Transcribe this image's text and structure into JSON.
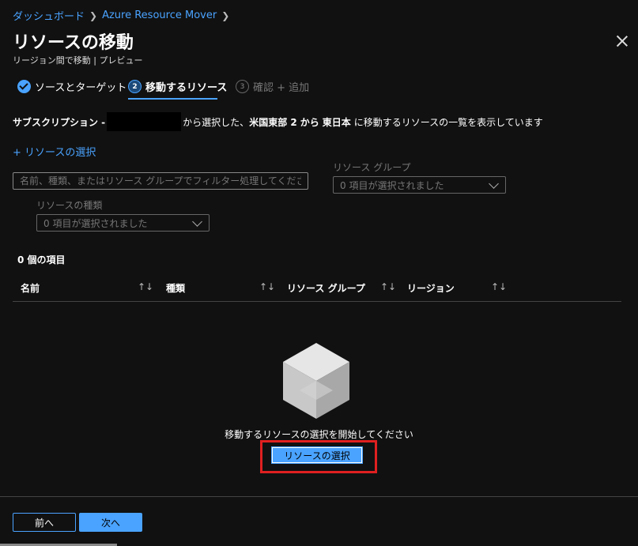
{
  "breadcrumb": [
    "ダッシュボード",
    "Azure Resource Mover"
  ],
  "header": {
    "title": "リソースの移動",
    "subtitle": "リージョン間で移動 | プレビュー"
  },
  "steps": [
    {
      "label": "ソースとターゲット",
      "state": "done"
    },
    {
      "number": "2",
      "label": "移動するリソース",
      "state": "active"
    },
    {
      "number": "3",
      "label": "確認 + 追加",
      "state": "disabled"
    }
  ],
  "subscription_line": {
    "prefix": "サブスクリプション -",
    "middle": "から選択した、",
    "source_region": "米国東部 2",
    "from_word": "から",
    "target_region": "東日本",
    "suffix": "に移動するリソースの一覧を表示しています"
  },
  "add_link": "+ リソースの選択",
  "filters": {
    "search_placeholder": "名前、種類、またはリソース グループでフィルター処理してください",
    "resource_group_label": "リソース グループ",
    "resource_group_value": "0 項目が選択されました",
    "resource_type_label": "リソースの種類",
    "resource_type_value": "0 項目が選択されました"
  },
  "item_count": "0 個の項目",
  "table": {
    "columns": [
      "名前",
      "種類",
      "リソース グループ",
      "リージョン"
    ],
    "sort_glyph": "↑↓"
  },
  "empty_state": {
    "message": "移動するリソースの選択を開始してください",
    "button": "リソースの選択"
  },
  "footer": {
    "prev": "前へ",
    "next": "次へ"
  },
  "colors": {
    "accent": "#4aa3ff",
    "background": "#111111",
    "highlight": "#e02020"
  }
}
